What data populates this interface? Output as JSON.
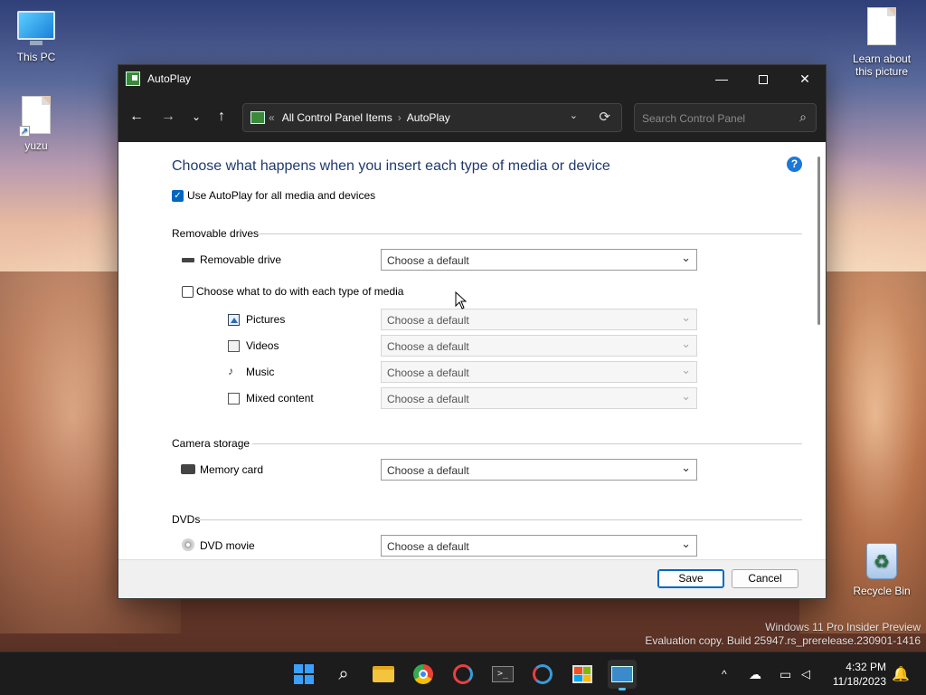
{
  "desktop": {
    "icons": [
      {
        "label": "This PC"
      },
      {
        "label": "yuzu"
      },
      {
        "label": "Learn about this picture"
      },
      {
        "label": "Recycle Bin"
      }
    ],
    "watermark_line1": "Windows 11 Pro Insider Preview",
    "watermark_line2": "Evaluation copy. Build 25947.rs_prerelease.230901-1416"
  },
  "window": {
    "title": "AutoPlay",
    "address": {
      "chevron": "«",
      "crumbs": [
        "All Control Panel Items",
        "AutoPlay"
      ],
      "separator": "›"
    },
    "search_placeholder": "Search Control Panel",
    "heading": "Choose what happens when you insert each type of media or device",
    "use_autoplay_label": "Use AutoPlay for all media and devices",
    "use_autoplay_checked": true,
    "sections": {
      "removable": {
        "title": "Removable drives",
        "drive_label": "Removable drive",
        "drive_value": "Choose a default",
        "per_media_label": "Choose what to do with each type of media",
        "per_media_checked": false,
        "media": [
          {
            "label": "Pictures",
            "value": "Choose a default"
          },
          {
            "label": "Videos",
            "value": "Choose a default"
          },
          {
            "label": "Music",
            "value": "Choose a default"
          },
          {
            "label": "Mixed content",
            "value": "Choose a default"
          }
        ]
      },
      "camera": {
        "title": "Camera storage",
        "label": "Memory card",
        "value": "Choose a default"
      },
      "dvds": {
        "title": "DVDs",
        "label": "DVD movie",
        "value": "Choose a default"
      }
    },
    "buttons": {
      "save": "Save",
      "cancel": "Cancel"
    }
  },
  "taskbar": {
    "time": "4:32 PM",
    "date": "11/18/2023"
  },
  "colors": {
    "accent": "#0067c0",
    "heading": "#1f3a6e",
    "titlebar": "#202020"
  }
}
